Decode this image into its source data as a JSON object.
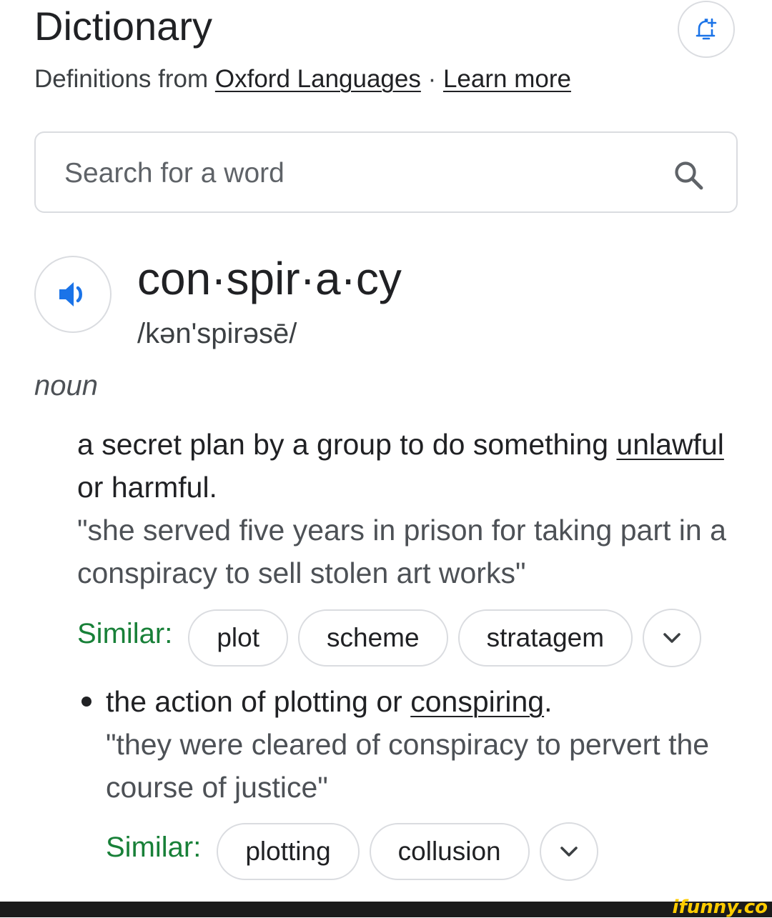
{
  "header": {
    "title": "Dictionary",
    "subtitle_prefix": "Definitions from ",
    "source_link": "Oxford Languages",
    "separator": " · ",
    "learn_more": "Learn more"
  },
  "search": {
    "placeholder": "Search for a word"
  },
  "entry": {
    "headword": "con·spir·a·cy",
    "phonetic": "/kən'spirəsē/",
    "part_of_speech": "noun",
    "senses": [
      {
        "def_before": "a secret plan by a group to do something ",
        "def_link": "unlawful",
        "def_after": " or harmful.",
        "example": "\"she served five years in prison for taking part in a conspiracy to sell stolen art works\"",
        "similar_label": "Similar:",
        "similar": [
          "plot",
          "scheme",
          "stratagem"
        ]
      },
      {
        "def_before": "the action of plotting or ",
        "def_link": "conspiring",
        "def_after": ".",
        "example": "\"they were cleared of conspiracy to pervert the course of justice\"",
        "similar_label": "Similar:",
        "similar": [
          "plotting",
          "collusion"
        ]
      }
    ]
  },
  "watermark": "ifunny.co",
  "colors": {
    "similar_label": "#188038",
    "speaker_icon": "#1a73e8",
    "border": "#dadce0"
  },
  "icons": [
    "alert-add-icon",
    "search-icon",
    "speaker-icon",
    "chevron-down-icon"
  ]
}
